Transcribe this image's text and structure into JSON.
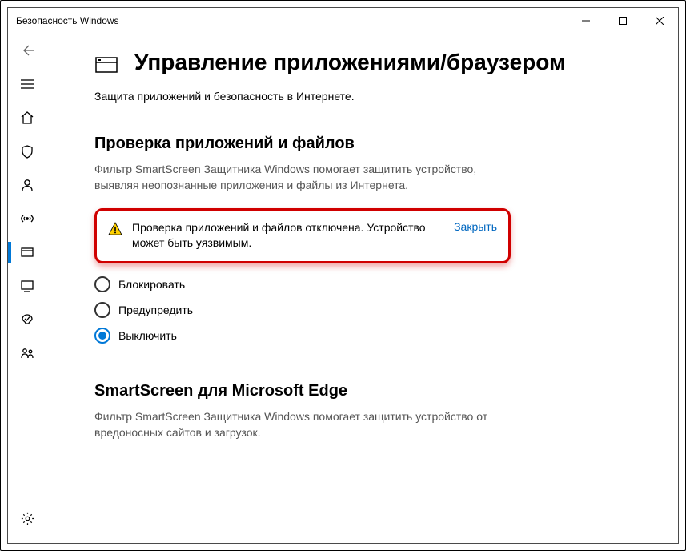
{
  "window": {
    "title": "Безопасность Windows"
  },
  "page": {
    "title": "Управление приложениями/браузером",
    "subtitle": "Защита приложений и безопасность в Интернете."
  },
  "section1": {
    "title": "Проверка приложений и файлов",
    "desc": "Фильтр SmartScreen Защитника Windows помогает защитить устройство, выявляя неопознанные приложения и файлы из Интернета.",
    "warning": "Проверка приложений и файлов отключена. Устройство может быть уязвимым.",
    "close": "Закрыть",
    "options": {
      "block": "Блокировать",
      "warn": "Предупредить",
      "off": "Выключить"
    }
  },
  "section2": {
    "title": "SmartScreen для Microsoft Edge",
    "desc": "Фильтр SmartScreen Защитника Windows помогает защитить устройство от вредоносных сайтов и загрузок."
  }
}
